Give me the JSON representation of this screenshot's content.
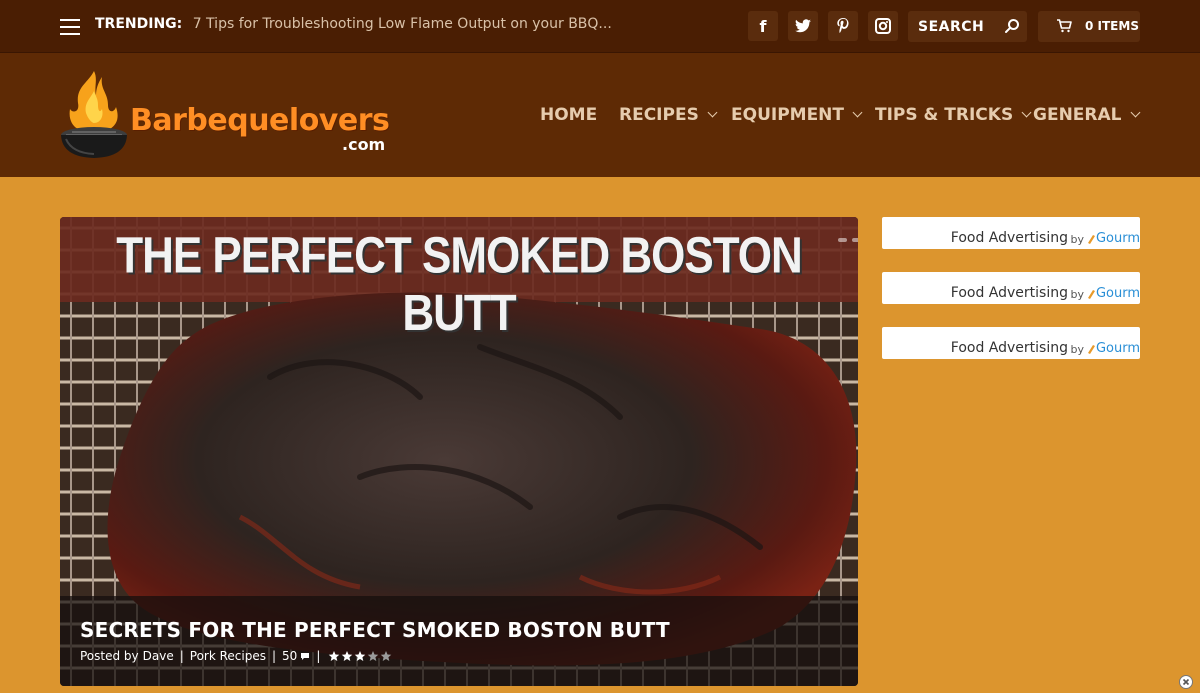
{
  "topbar": {
    "trending_label": "TRENDING:",
    "trending_text": "7 Tips for Troubleshooting Low Flame Output on your BBQ...",
    "social": [
      {
        "name": "facebook",
        "glyph": "f"
      },
      {
        "name": "twitter",
        "glyph": "t"
      },
      {
        "name": "pinterest",
        "glyph": "p"
      },
      {
        "name": "instagram",
        "glyph": "i"
      }
    ],
    "search_placeholder": "SEARCH",
    "cart_label": "0 ITEMS"
  },
  "header": {
    "logo_text": "Barbequelovers",
    "logo_sub": ".com",
    "nav": [
      {
        "label": "HOME",
        "has_dropdown": false
      },
      {
        "label": "RECIPES",
        "has_dropdown": true
      },
      {
        "label": "EQUIPMENT",
        "has_dropdown": true
      },
      {
        "label": "TIPS & TRICKS",
        "has_dropdown": true
      },
      {
        "label": "GENERAL",
        "has_dropdown": true
      }
    ]
  },
  "feature": {
    "banner_text": "THE PERFECT SMOKED BOSTON BUTT",
    "title": "SECRETS FOR THE PERFECT SMOKED BOSTON BUTT",
    "posted_by": "Posted by",
    "author": "Dave",
    "category": "Pork Recipes",
    "comments": "50",
    "rating": 3,
    "rating_max": 5
  },
  "ads": [
    {
      "text": "Food Advertising",
      "by": "by",
      "brand": "Gourm"
    },
    {
      "text": "Food Advertising",
      "by": "by",
      "brand": "Gourm"
    },
    {
      "text": "Food Advertising",
      "by": "by",
      "brand": "Gourm"
    }
  ],
  "colors": {
    "page_bg": "#dc952e",
    "topbar_bg": "#4a1e03",
    "header_bg": "#5e2a05",
    "logo_orange": "#ff8e24",
    "nav_text": "#e6ccae"
  }
}
